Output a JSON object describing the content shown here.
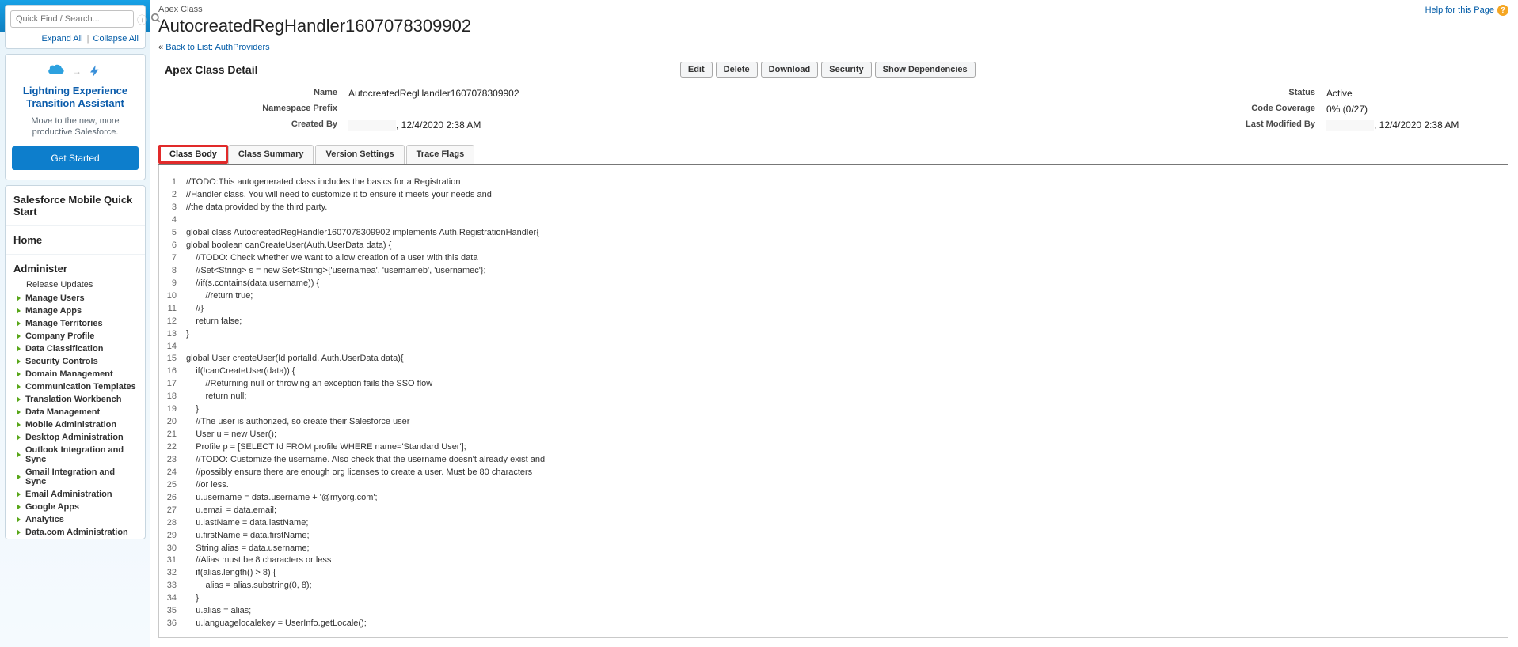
{
  "search": {
    "placeholder": "Quick Find / Search..."
  },
  "expand": {
    "expand": "Expand All",
    "collapse": "Collapse All"
  },
  "lex": {
    "title": "Lightning Experience Transition Assistant",
    "desc": "Move to the new, more productive Salesforce.",
    "cta": "Get Started"
  },
  "nav": {
    "quickstart": "Salesforce Mobile Quick Start",
    "home": "Home",
    "administer": "Administer",
    "release": "Release Updates",
    "items": [
      "Manage Users",
      "Manage Apps",
      "Manage Territories",
      "Company Profile",
      "Data Classification",
      "Security Controls",
      "Domain Management",
      "Communication Templates",
      "Translation Workbench",
      "Data Management",
      "Mobile Administration",
      "Desktop Administration",
      "Outlook Integration and Sync",
      "Gmail Integration and Sync",
      "Email Administration",
      "Google Apps",
      "Analytics",
      "Data.com Administration"
    ]
  },
  "header": {
    "crumb": "Apex Class",
    "title": "AutocreatedRegHandler1607078309902",
    "help": "Help for this Page"
  },
  "backlink": {
    "prefix": "« ",
    "text": "Back to List: AuthProviders"
  },
  "detail": {
    "title": "Apex Class Detail",
    "buttons": {
      "edit": "Edit",
      "delete": "Delete",
      "download": "Download",
      "security": "Security",
      "deps": "Show Dependencies"
    },
    "labels": {
      "name": "Name",
      "status": "Status",
      "ns": "Namespace Prefix",
      "coverage": "Code Coverage",
      "createdBy": "Created By",
      "modifiedBy": "Last Modified By"
    },
    "values": {
      "name": "AutocreatedRegHandler1607078309902",
      "status": "Active",
      "ns": "",
      "coverage": "0% (0/27)",
      "createdBy": ",  12/4/2020 2:38 AM",
      "modifiedBy": ",  12/4/2020 2:38 AM"
    }
  },
  "tabs": {
    "body": "Class Body",
    "summary": "Class Summary",
    "version": "Version Settings",
    "trace": "Trace Flags"
  },
  "code": [
    "//TODO:This autogenerated class includes the basics for a Registration",
    "//Handler class. You will need to customize it to ensure it meets your needs and",
    "//the data provided by the third party.",
    "",
    "global class AutocreatedRegHandler1607078309902 implements Auth.RegistrationHandler{",
    "global boolean canCreateUser(Auth.UserData data) {",
    "    //TODO: Check whether we want to allow creation of a user with this data",
    "    //Set<String> s = new Set<String>{'usernamea', 'usernameb', 'usernamec'};",
    "    //if(s.contains(data.username)) {",
    "        //return true;",
    "    //}",
    "    return false;",
    "}",
    "",
    "global User createUser(Id portalId, Auth.UserData data){",
    "    if(!canCreateUser(data)) {",
    "        //Returning null or throwing an exception fails the SSO flow",
    "        return null;",
    "    }",
    "    //The user is authorized, so create their Salesforce user",
    "    User u = new User();",
    "    Profile p = [SELECT Id FROM profile WHERE name='Standard User'];",
    "    //TODO: Customize the username. Also check that the username doesn't already exist and",
    "    //possibly ensure there are enough org licenses to create a user. Must be 80 characters",
    "    //or less.",
    "    u.username = data.username + '@myorg.com';",
    "    u.email = data.email;",
    "    u.lastName = data.lastName;",
    "    u.firstName = data.firstName;",
    "    String alias = data.username;",
    "    //Alias must be 8 characters or less",
    "    if(alias.length() > 8) {",
    "        alias = alias.substring(0, 8);",
    "    }",
    "    u.alias = alias;",
    "    u.languagelocalekey = UserInfo.getLocale();"
  ]
}
